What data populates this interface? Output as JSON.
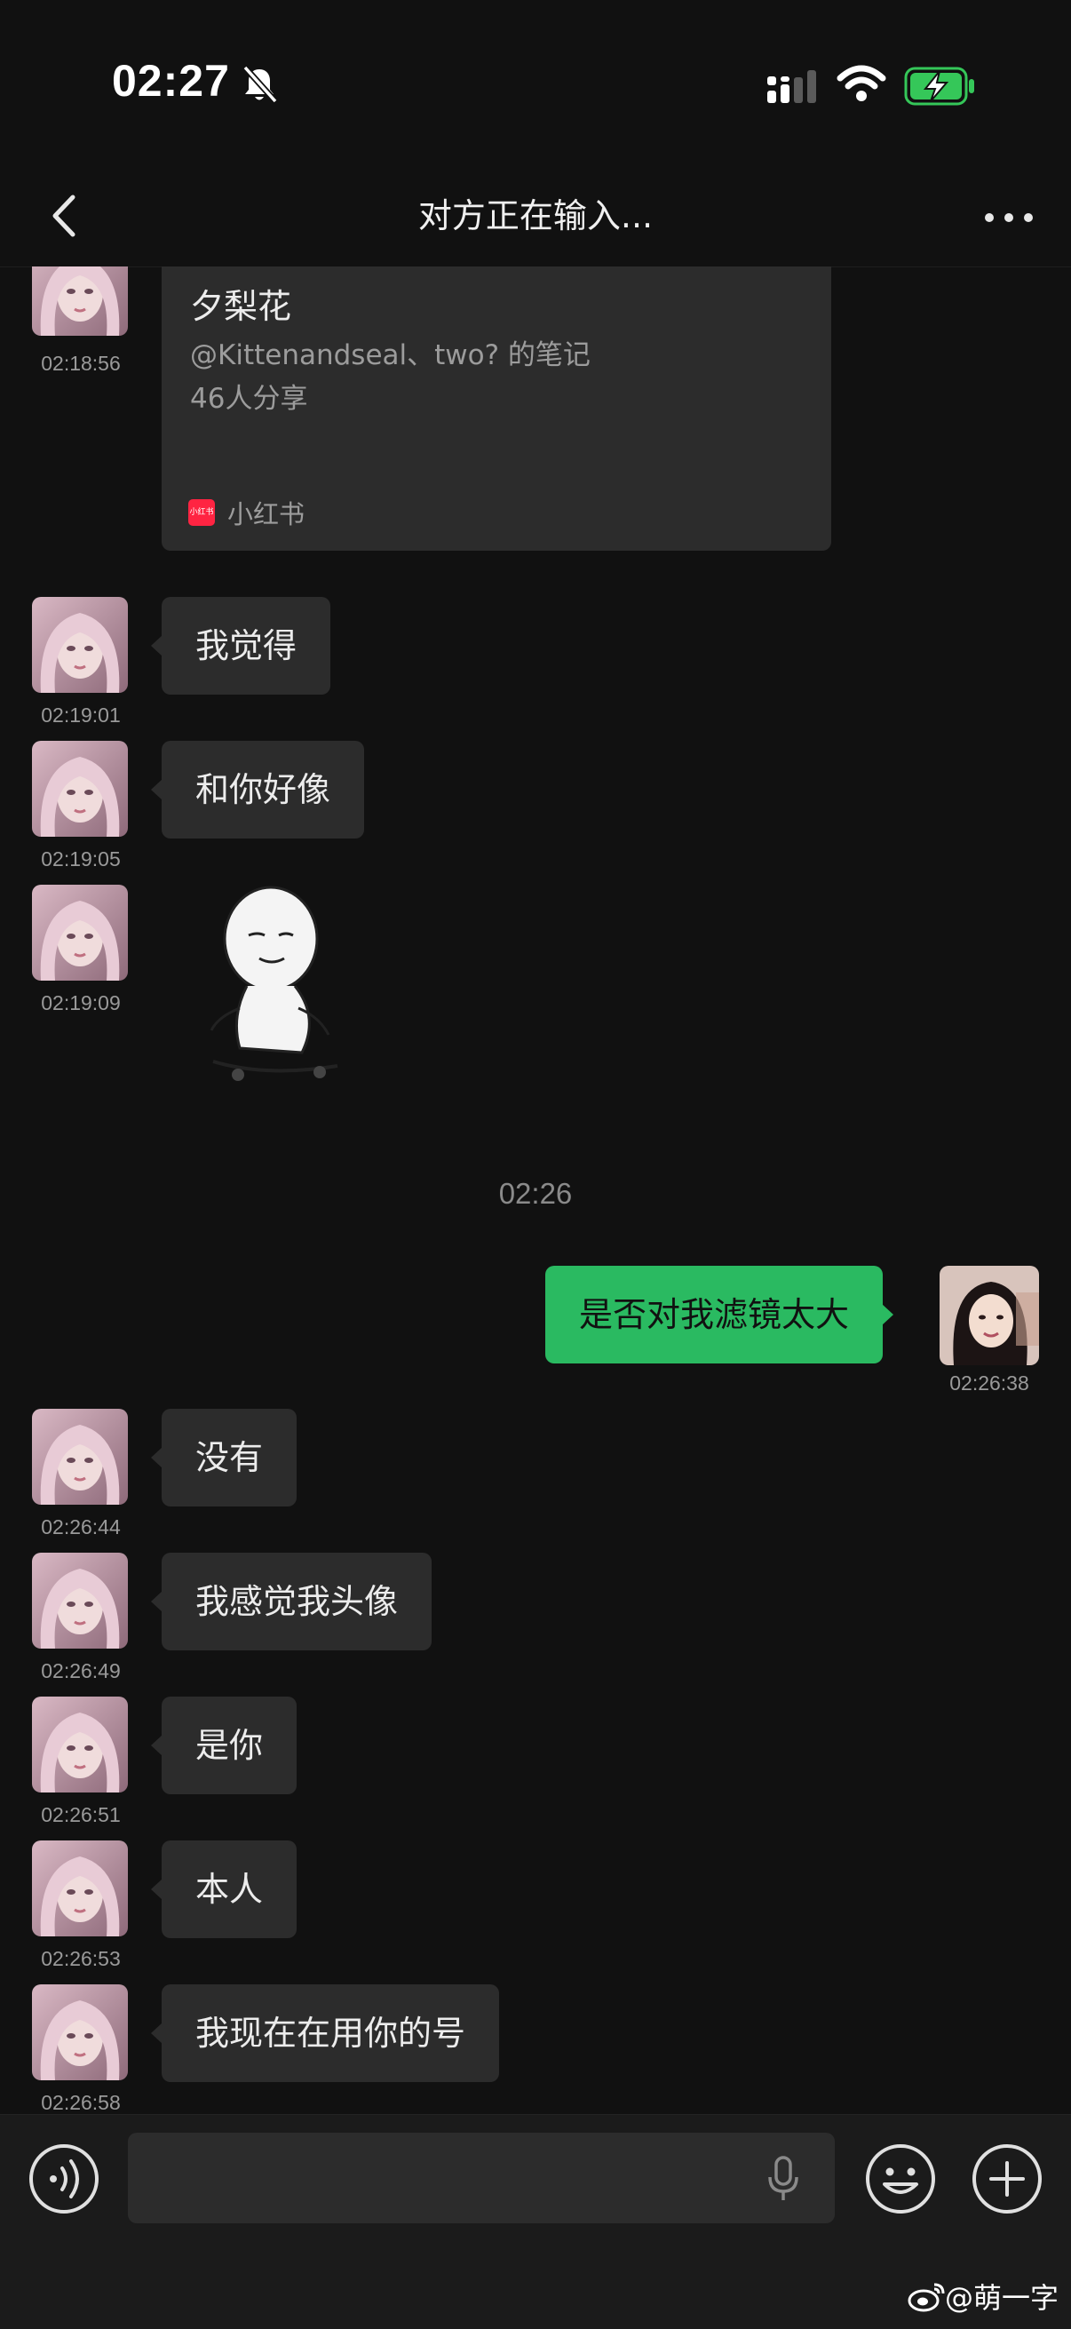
{
  "status_bar": {
    "time": "02:27",
    "battery_color": "#35c759"
  },
  "nav": {
    "title": "对方正在输入..."
  },
  "shared_card": {
    "title": "夕梨花",
    "description": "@Kittenandseal、two?  的笔记",
    "shares": "46人分享",
    "source": "小红书",
    "source_icon_text": "小红书",
    "timestamp": "02:18:56"
  },
  "messages": [
    {
      "text": "我觉得",
      "time": "02:19:01"
    },
    {
      "text": "和你好像",
      "time": "02:19:05"
    },
    {
      "sticker": "bald-figure-sticker",
      "time": "02:19:09"
    },
    {
      "text": "是否对我滤镜太大",
      "time": "02:26:38",
      "from": "me"
    },
    {
      "text": "没有",
      "time": "02:26:44"
    },
    {
      "text": "我感觉我头像",
      "time": "02:26:49"
    },
    {
      "text": "是你",
      "time": "02:26:51"
    },
    {
      "text": "本人",
      "time": "02:26:53"
    },
    {
      "text": "我现在在用你的号",
      "time": "02:26:58"
    }
  ],
  "center_time": "02:26",
  "input_bar": {
    "value": ""
  },
  "watermark": "@萌一字",
  "colors": {
    "background": "#111111",
    "bubble_other": "#2c2c2c",
    "bubble_me": "#2aba61"
  }
}
